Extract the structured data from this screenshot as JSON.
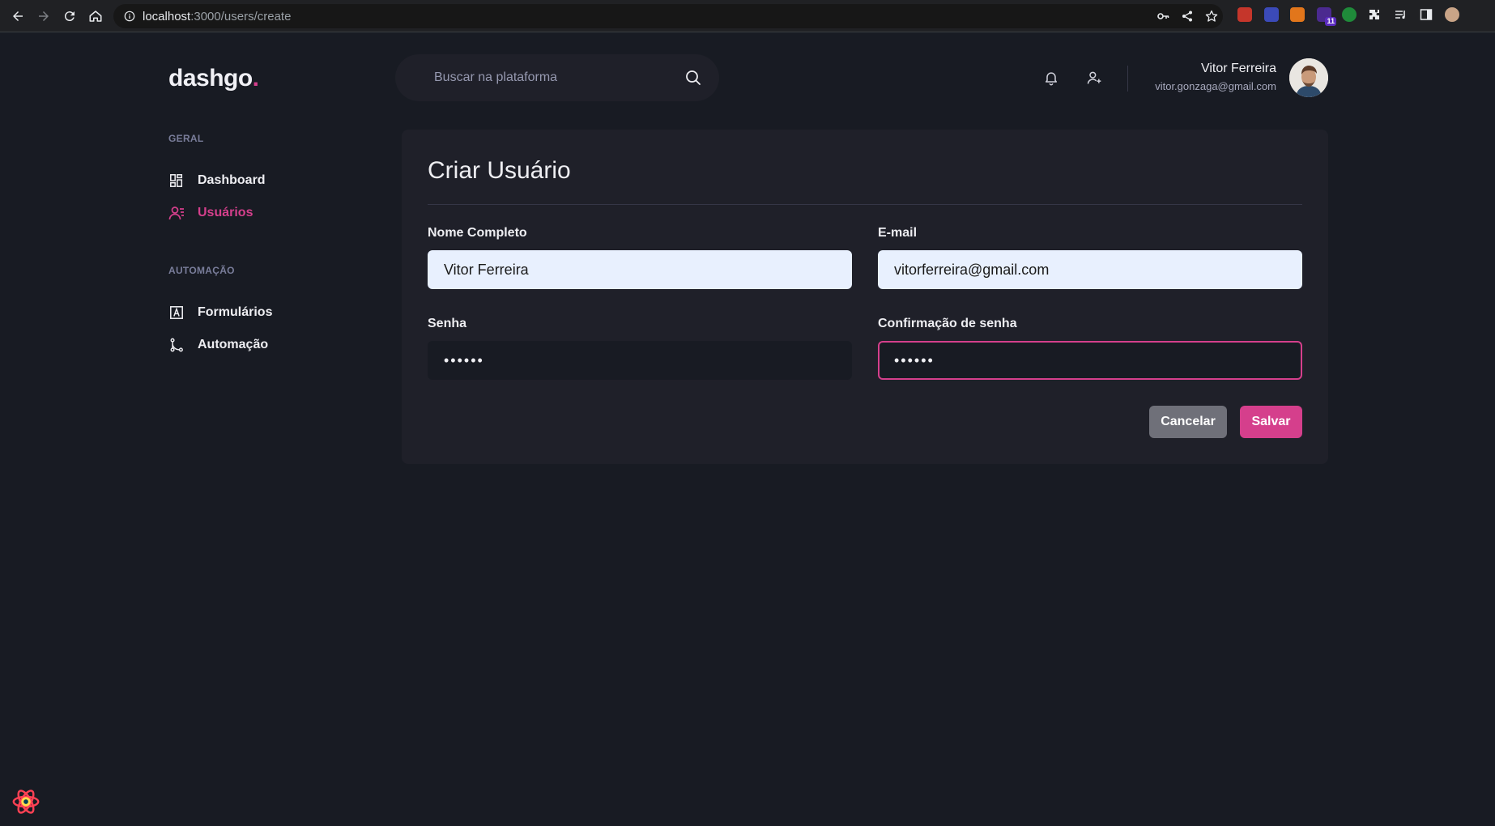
{
  "browser": {
    "url_host": "localhost",
    "url_path": ":3000/users/create",
    "extension_badge": "11"
  },
  "header": {
    "logo": "dashgo",
    "logo_dot": ".",
    "search_placeholder": "Buscar na plataforma",
    "user_name": "Vitor Ferreira",
    "user_email": "vitor.gonzaga@gmail.com"
  },
  "sidebar": {
    "sections": [
      {
        "title": "GERAL",
        "items": [
          {
            "label": "Dashboard",
            "icon": "dashboard-icon",
            "active": false
          },
          {
            "label": "Usuários",
            "icon": "users-icon",
            "active": true
          }
        ]
      },
      {
        "title": "AUTOMAÇÃO",
        "items": [
          {
            "label": "Formulários",
            "icon": "form-icon",
            "active": false
          },
          {
            "label": "Automação",
            "icon": "git-merge-icon",
            "active": false
          }
        ]
      }
    ]
  },
  "form": {
    "title": "Criar Usuário",
    "fields": {
      "name": {
        "label": "Nome Completo",
        "value": "Vitor Ferreira"
      },
      "email": {
        "label": "E-mail",
        "value": "vitorferreira@gmail.com"
      },
      "password": {
        "label": "Senha",
        "value": "••••••"
      },
      "password_confirmation": {
        "label": "Confirmação de senha",
        "value": "••••••"
      }
    },
    "cancel_label": "Cancelar",
    "save_label": "Salvar"
  },
  "colors": {
    "background": "#181b23",
    "card": "#1f2029",
    "accent": "#d53f8c",
    "cancel": "#6f7079",
    "autofill": "#e8f0fe"
  }
}
